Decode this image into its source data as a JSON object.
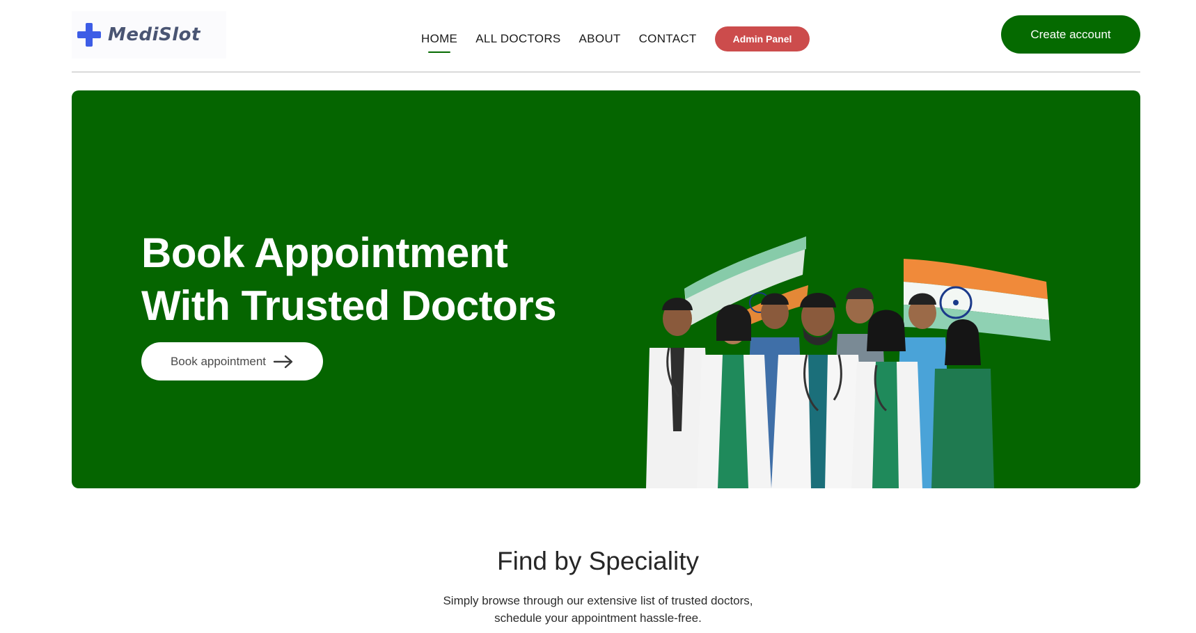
{
  "brand": {
    "name": "MediSlot",
    "icon": "medical-cross-icon",
    "color": "#3d5de6"
  },
  "nav": {
    "items": [
      {
        "label": "HOME",
        "active": true
      },
      {
        "label": "ALL DOCTORS",
        "active": false
      },
      {
        "label": "ABOUT",
        "active": false
      },
      {
        "label": "CONTACT",
        "active": false
      }
    ],
    "admin_label": "Admin Panel",
    "create_account_label": "Create account"
  },
  "hero": {
    "title_line1": "Book Appointment",
    "title_line2": "With Trusted Doctors",
    "cta_label": "Book appointment",
    "cta_icon": "arrow-right-icon",
    "illustration": "group-of-doctors-with-indian-flags"
  },
  "speciality": {
    "title": "Find by Speciality",
    "subtitle_line1": "Simply browse through our extensive list of trusted doctors,",
    "subtitle_line2": "schedule your appointment hassle-free."
  },
  "colors": {
    "primary_green": "#056500",
    "admin_red": "#cc4c4c",
    "white": "#ffffff"
  }
}
